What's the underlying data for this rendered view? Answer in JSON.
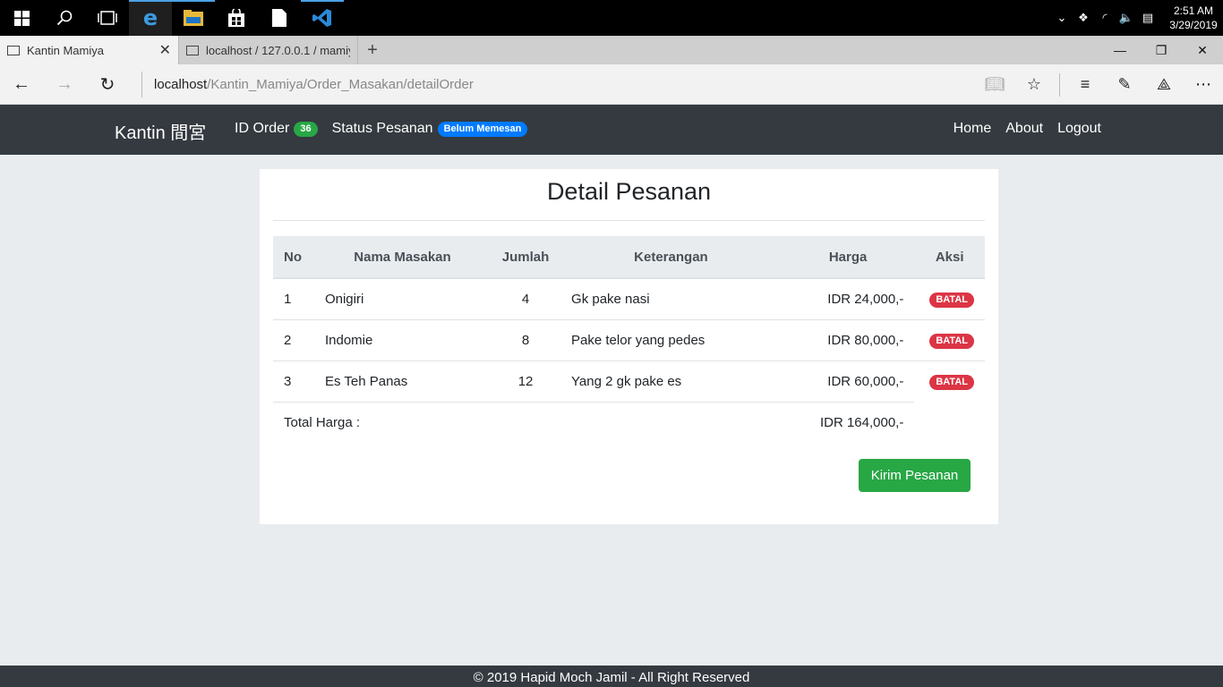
{
  "taskbar": {
    "time": "2:51 AM",
    "date": "3/29/2019",
    "icons": [
      "windows-start-icon",
      "search-icon",
      "task-view-icon",
      "edge-icon",
      "file-explorer-icon",
      "store-icon",
      "document-icon",
      "vscode-icon"
    ]
  },
  "browser": {
    "tabs": [
      {
        "title": "Kantin Mamiya",
        "active": true
      },
      {
        "title": "localhost / 127.0.0.1 / mamiya",
        "active": false
      }
    ],
    "url_host": "localhost",
    "url_path": "/Kantin_Mamiya/Order_Masakan/detailOrder"
  },
  "navbar": {
    "brand": "Kantin 間宮",
    "id_order_label": "ID Order",
    "id_order_value": "36",
    "status_label": "Status Pesanan",
    "status_value": "Belum Memesan",
    "links": [
      "Home",
      "About",
      "Logout"
    ]
  },
  "page": {
    "title": "Detail Pesanan",
    "columns": [
      "No",
      "Nama Masakan",
      "Jumlah",
      "Keterangan",
      "Harga",
      "Aksi"
    ],
    "rows": [
      {
        "no": "1",
        "nama": "Onigiri",
        "jumlah": "4",
        "keterangan": "Gk pake nasi",
        "harga": "IDR 24,000,-",
        "aksi": "BATAL"
      },
      {
        "no": "2",
        "nama": "Indomie",
        "jumlah": "8",
        "keterangan": "Pake telor yang pedes",
        "harga": "IDR 80,000,-",
        "aksi": "BATAL"
      },
      {
        "no": "3",
        "nama": "Es Teh Panas",
        "jumlah": "12",
        "keterangan": "Yang 2 gk pake es",
        "harga": "IDR 60,000,-",
        "aksi": "BATAL"
      }
    ],
    "total_label": "Total Harga :",
    "total_value": "IDR 164,000,-",
    "submit_label": "Kirim Pesanan"
  },
  "footer": {
    "text": "© 2019 Hapid Moch Jamil - All Right Reserved"
  },
  "colors": {
    "navbar": "#343a40",
    "success": "#28a745",
    "primary": "#007bff",
    "danger": "#dc3545"
  }
}
